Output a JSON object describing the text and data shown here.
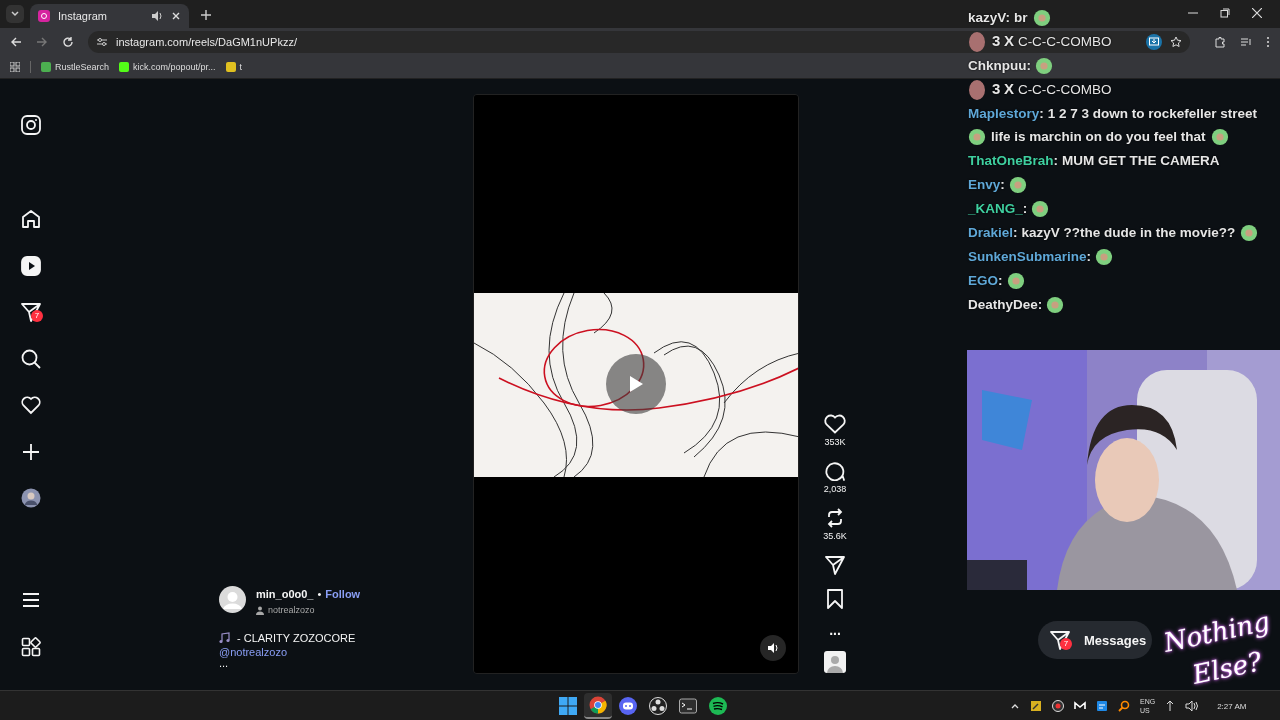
{
  "browser": {
    "tab": {
      "title": "Instagram"
    },
    "url": "instagram.com/reels/DaGM1nUPkzz/",
    "bookmarks": [
      {
        "label": "RustleSearch",
        "color": "#4caf50"
      },
      {
        "label": "kick.com/popout/pr...",
        "color": "#53fc18"
      },
      {
        "label": "t",
        "color": "#e0c020"
      }
    ]
  },
  "nav": {
    "items": [
      {
        "kind": "home",
        "selected": false
      },
      {
        "kind": "reels",
        "selected": true
      },
      {
        "kind": "messages",
        "selected": false,
        "badge": "7"
      },
      {
        "kind": "search",
        "selected": false
      },
      {
        "kind": "heart",
        "selected": false
      },
      {
        "kind": "plus",
        "selected": false
      },
      {
        "kind": "avatar",
        "selected": false
      }
    ]
  },
  "reel": {
    "author": "min_o0o0_",
    "separator": "•",
    "follow": "Follow",
    "audio": "notrealzozo",
    "caption": "- CLARITY ZOZOCORE",
    "mention": "@notrealzozo",
    "more": "...",
    "actions": [
      {
        "kind": "like",
        "count": "353K"
      },
      {
        "kind": "comment",
        "count": "2,038"
      },
      {
        "kind": "repost",
        "count": "35.6K"
      },
      {
        "kind": "share"
      },
      {
        "kind": "save"
      },
      {
        "kind": "more",
        "label": "..."
      },
      {
        "kind": "audio"
      }
    ]
  },
  "messages": {
    "label": "Messages",
    "badge": "7"
  },
  "chat": [
    {
      "kind": "message",
      "user": "kazyV",
      "sep": ":",
      "color": "#e6e6e6",
      "parts": [
        {
          "kind": "text",
          "text": "br"
        },
        {
          "kind": "emote"
        }
      ]
    },
    {
      "kind": "combo",
      "count": "3",
      "times": "X",
      "text": "C-C-C-COMBO"
    },
    {
      "kind": "message",
      "user": "Chknpuu",
      "sep": ":",
      "color": "#e6e6e6",
      "parts": [
        {
          "kind": "emote"
        }
      ]
    },
    {
      "kind": "combo",
      "count": "3",
      "times": "X",
      "text": "C-C-C-COMBO"
    },
    {
      "kind": "message",
      "user": "Maplestory",
      "sep": ":",
      "color": "#5fa8d8",
      "parts": [
        {
          "kind": "text",
          "text": "1 2 7 3 down to rockefeller street"
        },
        {
          "kind": "emote"
        },
        {
          "kind": "text",
          "text": "life is marchin on do you feel that"
        },
        {
          "kind": "emote"
        }
      ]
    },
    {
      "kind": "message",
      "user": "ThatOneBrah",
      "sep": ":",
      "color": "#3fd0a0",
      "parts": [
        {
          "kind": "text",
          "text": "MUM GET THE CAMERA"
        }
      ]
    },
    {
      "kind": "message",
      "user": "Envy",
      "sep": ":",
      "color": "#5fa8d8",
      "parts": [
        {
          "kind": "emote"
        }
      ]
    },
    {
      "kind": "message",
      "user": "_KANG_",
      "sep": ":",
      "color": "#3fd0a0",
      "parts": [
        {
          "kind": "emote"
        }
      ]
    },
    {
      "kind": "message",
      "user": "Drakiel",
      "sep": ":",
      "color": "#5fa8d8",
      "parts": [
        {
          "kind": "text",
          "text": "kazyV ??the dude in the movie??"
        },
        {
          "kind": "emote"
        }
      ]
    },
    {
      "kind": "message",
      "user": "SunkenSubmarine",
      "sep": ":",
      "color": "#5fa8d8",
      "parts": [
        {
          "kind": "emote"
        }
      ]
    },
    {
      "kind": "message",
      "user": "EGO",
      "sep": ":",
      "color": "#5fa8d8",
      "parts": [
        {
          "kind": "emote"
        }
      ]
    },
    {
      "kind": "message",
      "user": "DeathyDee",
      "sep": ":",
      "color": "#e6e6e6",
      "parts": [
        {
          "kind": "emote"
        }
      ]
    }
  ],
  "overlay_logo": {
    "line_1": "Nothing",
    "line_2": "Else?"
  },
  "taskbar": {
    "apps": [
      {
        "kind": "start",
        "selected": false
      },
      {
        "kind": "chrome",
        "selected": true
      },
      {
        "kind": "discord",
        "selected": false
      },
      {
        "kind": "obs",
        "selected": false
      },
      {
        "kind": "terminal",
        "selected": false
      },
      {
        "kind": "spotify",
        "selected": false
      }
    ],
    "language": "ENG",
    "region": "US",
    "time": "2:27 AM"
  }
}
